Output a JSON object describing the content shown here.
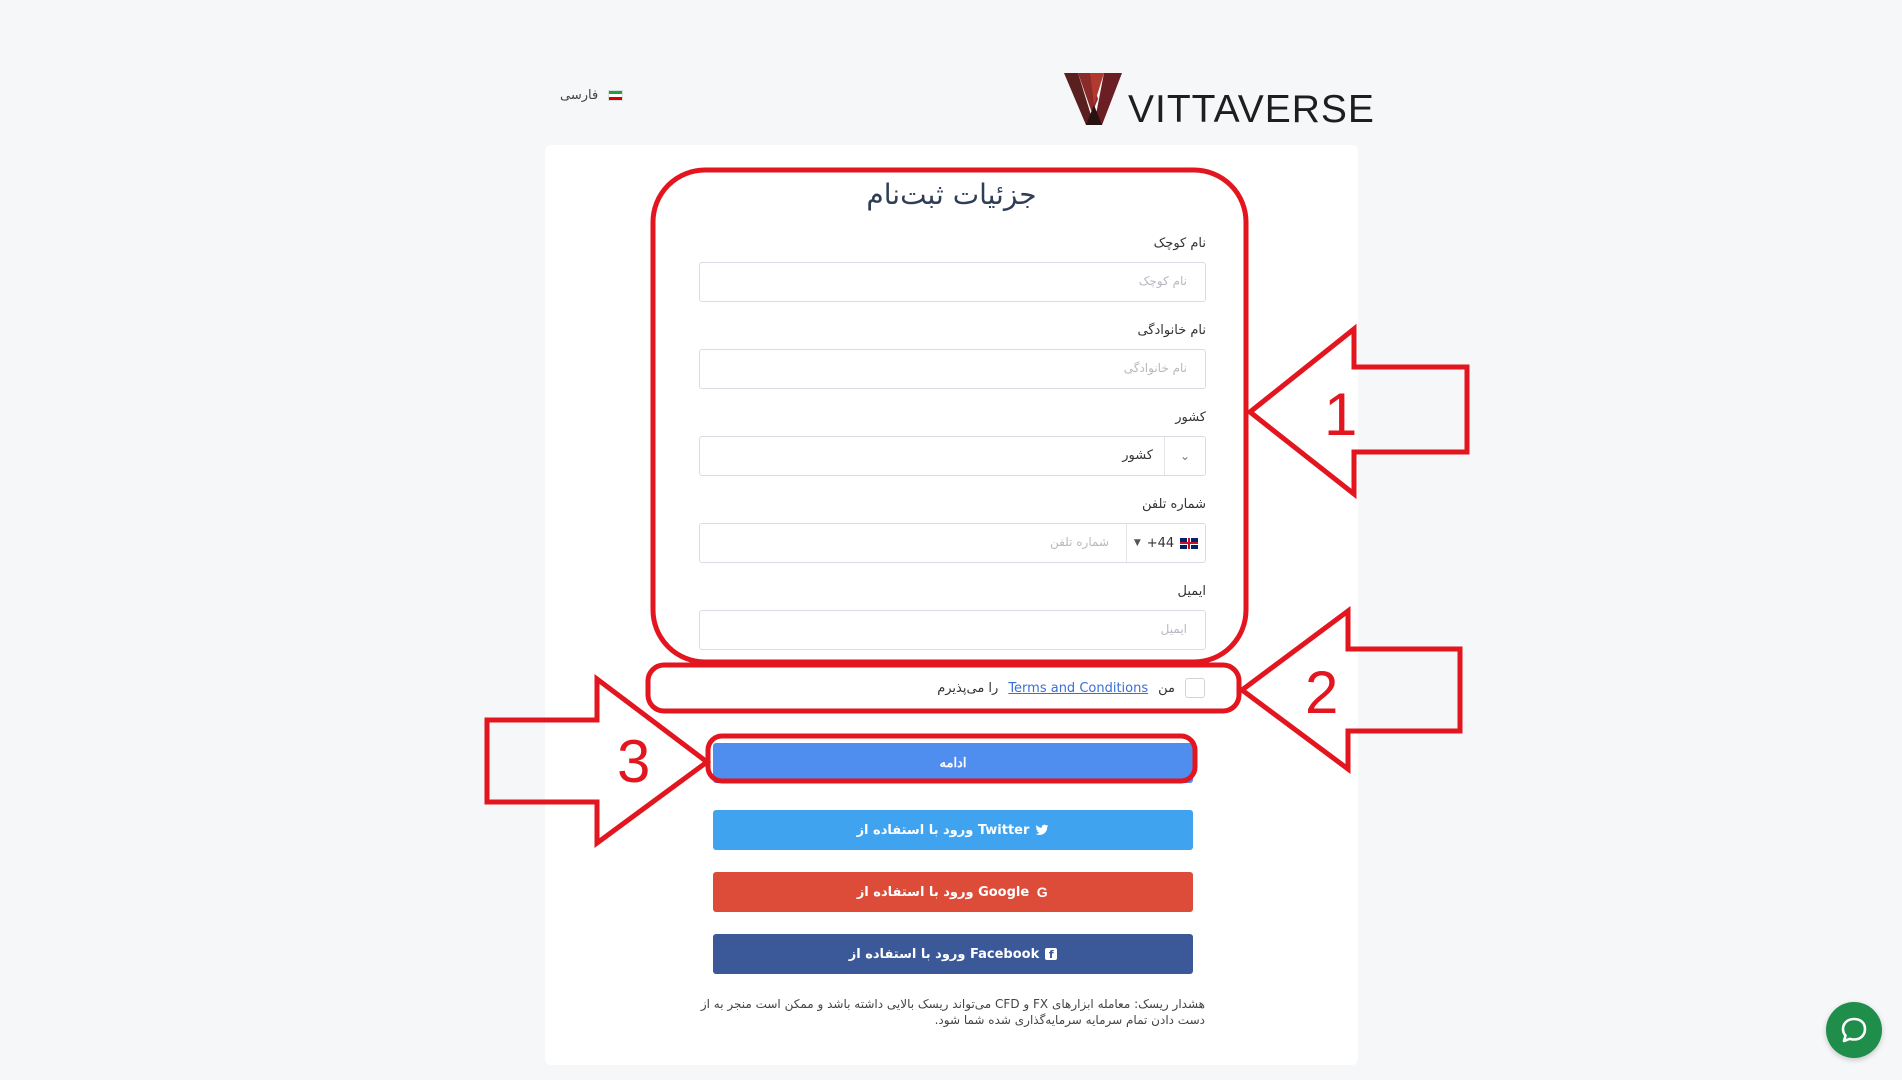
{
  "language": {
    "label": "فارسی"
  },
  "brand": {
    "name": "VITTAVERSE"
  },
  "form": {
    "title": "جزئیات ثبت‌نام",
    "first_name": {
      "label": "نام کوچک",
      "placeholder": "نام کوچک"
    },
    "last_name": {
      "label": "نام خانوادگی",
      "placeholder": "نام خانوادگی"
    },
    "country": {
      "label": "کشور",
      "value": "کشور"
    },
    "phone": {
      "label": "شماره تلفن",
      "prefix": "+44",
      "placeholder": "شماره تلفن"
    },
    "email": {
      "label": "ایمیل",
      "placeholder": "ایمیل"
    },
    "terms": {
      "before": "من",
      "link": "Terms and Conditions",
      "after": "را می‌پذیرم"
    },
    "continue_label": "ادامه"
  },
  "social": {
    "twitter_label": "ورود با استفاده از Twitter",
    "google_label": "ورود با استفاده از Google",
    "facebook_label": "ورود با استفاده از Facebook"
  },
  "risk_warning": "هشدار ریسک: معامله ابزارهای FX و CFD می‌تواند ریسک بالایی داشته باشد و ممکن است منجر به از دست دادن تمام سرمایه سرمایه‌گذاری شده شما شود.",
  "annotations": {
    "one": "1",
    "two": "2",
    "three": "3"
  },
  "colors": {
    "primary": "#4f8def",
    "twitter": "#3fa3ef",
    "google": "#dd4b39",
    "facebook": "#3b5998",
    "annotation": "#e3161f",
    "chat": "#1e8e4a"
  }
}
